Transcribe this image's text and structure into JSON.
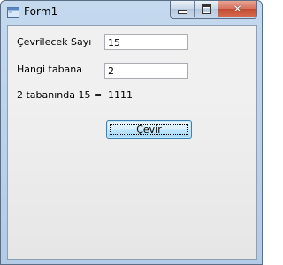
{
  "window": {
    "title": "Form1"
  },
  "caption_buttons": {
    "minimize": "minimize-icon",
    "maximize": "maximize-icon",
    "close": "close-icon"
  },
  "form": {
    "input_label": "Çevrilecek Sayı",
    "input_value": "15",
    "base_label": "Hangi tabana",
    "base_value": "2",
    "result_label": "2 tabanında 15 =",
    "result_value": "1111",
    "convert_button": "Çevir"
  },
  "colors": {
    "titlebar": "#b9d1ea",
    "close_button": "#c84530",
    "button_border": "#3c7fb1"
  }
}
